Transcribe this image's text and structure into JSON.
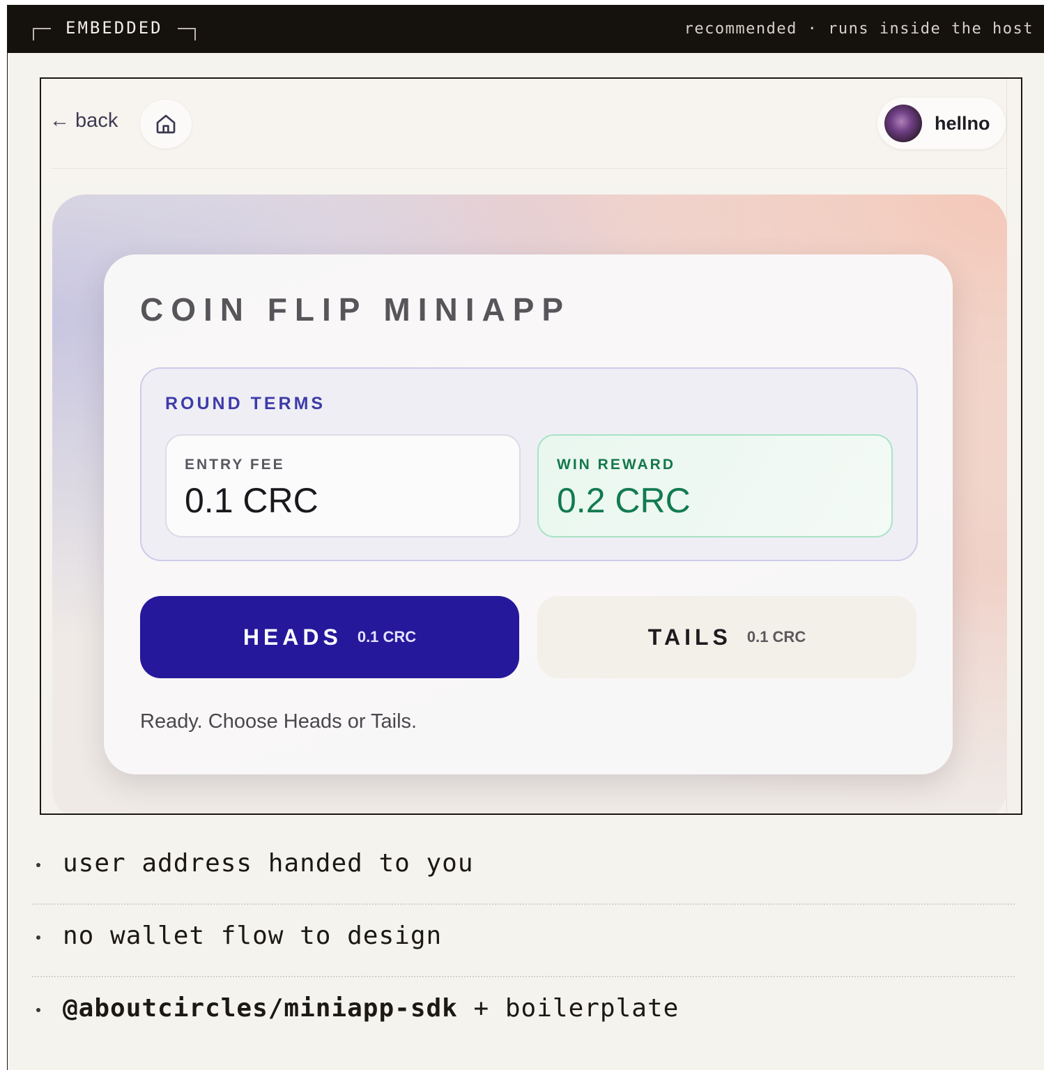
{
  "topbar": {
    "label": "EMBEDDED",
    "meta": "recommended · runs inside the host"
  },
  "embed": {
    "back_label": "← back",
    "user_name": "hellno",
    "card": {
      "title": "COIN FLIP MINIAPP",
      "terms_title": "ROUND TERMS",
      "entry_fee_label": "ENTRY FEE",
      "entry_fee_value": "0.1 CRC",
      "win_reward_label": "WIN REWARD",
      "win_reward_value": "0.2 CRC",
      "heads_label": "HEADS",
      "heads_price": "0.1 CRC",
      "tails_label": "TAILS",
      "tails_price": "0.1 CRC",
      "status": "Ready. Choose Heads or Tails."
    }
  },
  "bullets": {
    "item1": "user address handed to you",
    "item2": "no wallet flow to design",
    "item3_code": "@aboutcircles/miniapp-sdk",
    "item3_rest": " + boilerplate"
  },
  "colors": {
    "topbar_bg": "#15110d",
    "accent_indigo": "#25189b",
    "reward_green": "#127a51"
  }
}
